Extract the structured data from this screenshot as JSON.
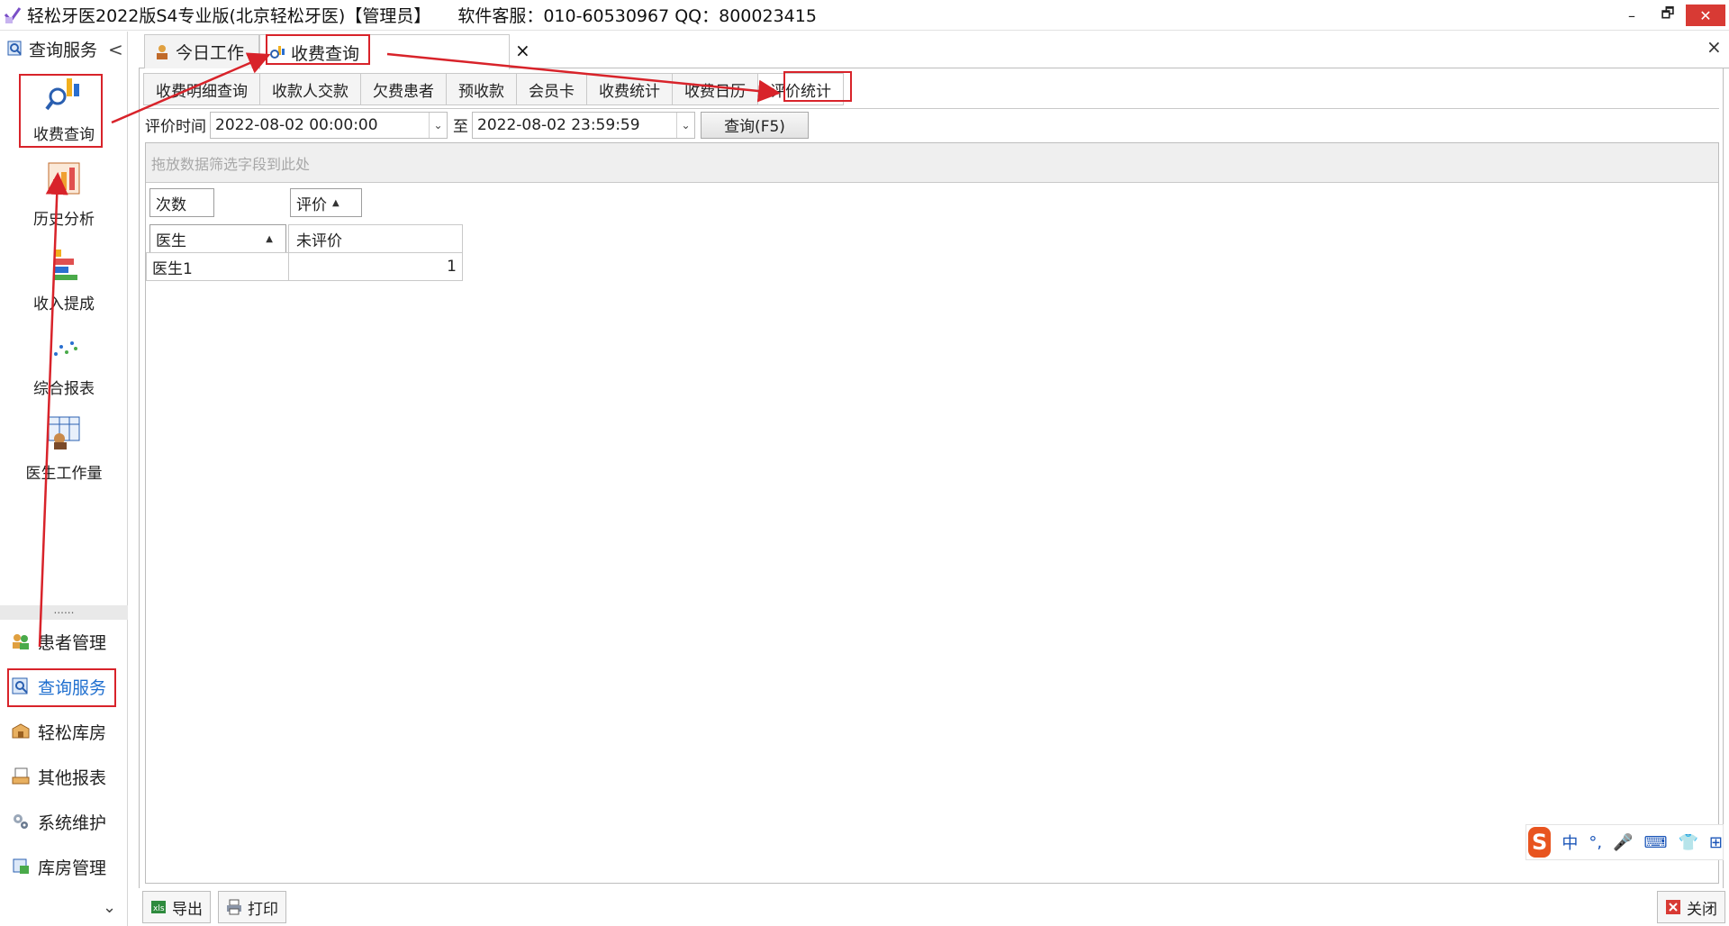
{
  "window": {
    "title": "轻松牙医2022版S4专业版(北京轻松牙医)【管理员】",
    "support": "软件客服：010-60530967 QQ：800023415",
    "min_glyph": "–",
    "restore_glyph": "🗗",
    "close_glyph": "✕"
  },
  "sidebar": {
    "header": "查询服务",
    "collapse_glyph": "<",
    "modules": [
      {
        "label": "收费查询",
        "icon": "fee-query-icon"
      },
      {
        "label": "历史分析",
        "icon": "history-analysis-icon"
      },
      {
        "label": "收入提成",
        "icon": "income-commission-icon"
      },
      {
        "label": "综合报表",
        "icon": "comprehensive-report-icon"
      },
      {
        "label": "医生工作量",
        "icon": "doctor-workload-icon"
      }
    ],
    "grip": "......",
    "nav": [
      {
        "label": "患者管理",
        "icon": "patients-icon"
      },
      {
        "label": "查询服务",
        "icon": "query-service-icon"
      },
      {
        "label": "轻松库房",
        "icon": "warehouse-icon"
      },
      {
        "label": "其他报表",
        "icon": "other-reports-icon"
      },
      {
        "label": "系统维护",
        "icon": "system-maintenance-icon"
      },
      {
        "label": "库房管理",
        "icon": "warehouse-management-icon"
      }
    ],
    "down_glyph": "⌄"
  },
  "doc_tabs": [
    {
      "label": "今日工作"
    },
    {
      "label": "收费查询"
    }
  ],
  "doc_tab_close": "×",
  "close_all": "×",
  "sub_tabs": [
    "收费明细查询",
    "收款人交款",
    "欠费患者",
    "预收款",
    "会员卡",
    "收费统计",
    "收费日历",
    "评价统计"
  ],
  "filter": {
    "label": "评价时间",
    "start": "2022-08-02 00:00:00",
    "to": "至",
    "end": "2022-08-02 23:59:59",
    "query_button": "查询(F5)",
    "dropdown_glyph": "⌄"
  },
  "pivot": {
    "drop_hint": "拖放数据筛选字段到此处",
    "data_field": "次数",
    "column_field": "评价",
    "row_field": "医生",
    "sort_glyph": "▲",
    "column_headers": [
      "未评价"
    ],
    "rows": [
      {
        "label": "医生1",
        "values": [
          "1"
        ]
      }
    ]
  },
  "bottom": {
    "export": "导出",
    "print": "打印",
    "close": "关闭"
  },
  "ime": {
    "logo": "S",
    "items": [
      "中",
      "°,",
      "🎤",
      "⌨",
      "👕",
      "⊞"
    ]
  },
  "colors": {
    "annotation": "#d8232a",
    "active_nav": "#1f6fcf",
    "close_red": "#d83a34"
  }
}
